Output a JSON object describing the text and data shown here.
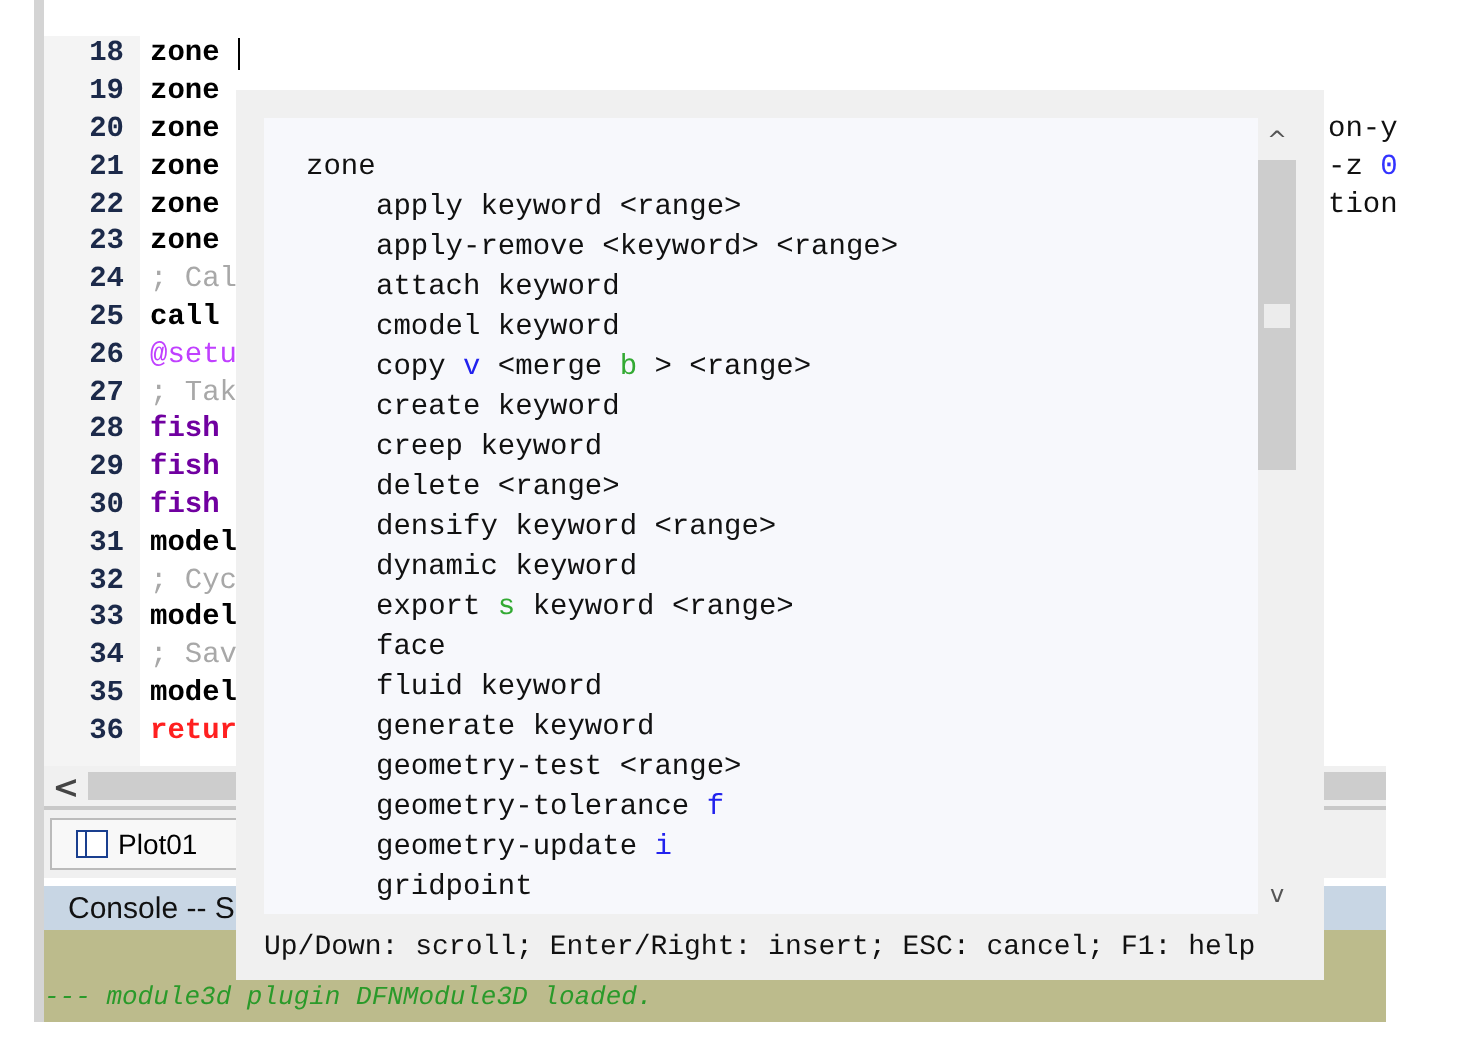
{
  "editor": {
    "lines": [
      {
        "number": "18",
        "segments": [
          {
            "text": "zone",
            "kind": "keyword"
          }
        ],
        "cursor": true
      },
      {
        "number": "19",
        "segments": [
          {
            "text": "zone",
            "kind": "keyword"
          }
        ],
        "cursor": false
      },
      {
        "number": "20",
        "segments": [
          {
            "text": "zone",
            "kind": "keyword"
          }
        ],
        "tail": [
          {
            "text": "on-y",
            "kind": "plain"
          }
        ],
        "cursor": false
      },
      {
        "number": "21",
        "segments": [
          {
            "text": "zone",
            "kind": "keyword"
          }
        ],
        "tail": [
          {
            "text": "-z ",
            "kind": "plain"
          },
          {
            "text": "0",
            "kind": "number"
          }
        ],
        "cursor": false
      },
      {
        "number": "22",
        "segments": [
          {
            "text": "zone",
            "kind": "keyword"
          }
        ],
        "tail": [
          {
            "text": "tion",
            "kind": "plain"
          }
        ],
        "cursor": false
      },
      {
        "number": "23",
        "segments": [
          {
            "text": "zone",
            "kind": "keyword"
          }
        ],
        "cursor": false
      },
      {
        "number": "24",
        "segments": [
          {
            "text": "; Cal",
            "kind": "comment"
          }
        ],
        "cursor": false
      },
      {
        "number": "25",
        "segments": [
          {
            "text": "call",
            "kind": "keyword"
          }
        ],
        "cursor": false
      },
      {
        "number": "26",
        "segments": [
          {
            "text": "@setu",
            "kind": "macro"
          }
        ],
        "cursor": false
      },
      {
        "number": "27",
        "segments": [
          {
            "text": "; Tak",
            "kind": "comment"
          }
        ],
        "cursor": false
      },
      {
        "number": "28",
        "segments": [
          {
            "text": "fish",
            "kind": "fish"
          }
        ],
        "cursor": false
      },
      {
        "number": "29",
        "segments": [
          {
            "text": "fish",
            "kind": "fish"
          }
        ],
        "cursor": false
      },
      {
        "number": "30",
        "segments": [
          {
            "text": "fish",
            "kind": "fish"
          }
        ],
        "cursor": false
      },
      {
        "number": "31",
        "segments": [
          {
            "text": "model",
            "kind": "keyword"
          }
        ],
        "cursor": false
      },
      {
        "number": "32",
        "segments": [
          {
            "text": "; Cyc",
            "kind": "comment"
          }
        ],
        "cursor": false
      },
      {
        "number": "33",
        "segments": [
          {
            "text": "model",
            "kind": "keyword"
          }
        ],
        "cursor": false
      },
      {
        "number": "34",
        "segments": [
          {
            "text": "; Sav",
            "kind": "comment"
          }
        ],
        "cursor": false
      },
      {
        "number": "35",
        "segments": [
          {
            "text": "model",
            "kind": "keyword"
          }
        ],
        "cursor": false
      },
      {
        "number": "36",
        "segments": [
          {
            "text": "retur",
            "kind": "return"
          }
        ],
        "cursor": false
      }
    ],
    "scroll_left": "<"
  },
  "tabs": [
    {
      "label": "Plot01",
      "selected": true
    }
  ],
  "console": {
    "title": "Console -- S",
    "output": "--- module3d plugin DFNModule3D loaded."
  },
  "completion_popup": {
    "root": {
      "label": "zone",
      "children": [
        {
          "segments": [
            {
              "text": "apply keyword <range>",
              "kind": "plain"
            }
          ]
        },
        {
          "segments": [
            {
              "text": "apply-remove <keyword> <range>",
              "kind": "plain"
            }
          ]
        },
        {
          "segments": [
            {
              "text": "attach keyword",
              "kind": "plain"
            }
          ]
        },
        {
          "segments": [
            {
              "text": "cmodel keyword",
              "kind": "plain"
            }
          ]
        },
        {
          "segments": [
            {
              "text": "copy ",
              "kind": "plain"
            },
            {
              "text": "v",
              "kind": "vector"
            },
            {
              "text": " <merge ",
              "kind": "plain"
            },
            {
              "text": "b",
              "kind": "boolean"
            },
            {
              "text": " > <range>",
              "kind": "plain"
            }
          ]
        },
        {
          "segments": [
            {
              "text": "create keyword",
              "kind": "plain"
            }
          ]
        },
        {
          "segments": [
            {
              "text": "creep keyword",
              "kind": "plain"
            }
          ]
        },
        {
          "segments": [
            {
              "text": "delete <range>",
              "kind": "plain"
            }
          ]
        },
        {
          "segments": [
            {
              "text": "densify keyword <range>",
              "kind": "plain"
            }
          ]
        },
        {
          "segments": [
            {
              "text": "dynamic keyword",
              "kind": "plain"
            }
          ]
        },
        {
          "segments": [
            {
              "text": "export ",
              "kind": "plain"
            },
            {
              "text": "s",
              "kind": "string"
            },
            {
              "text": " keyword <range>",
              "kind": "plain"
            }
          ]
        },
        {
          "segments": [
            {
              "text": "face",
              "kind": "plain"
            }
          ]
        },
        {
          "segments": [
            {
              "text": "fluid keyword",
              "kind": "plain"
            }
          ]
        },
        {
          "segments": [
            {
              "text": "generate keyword",
              "kind": "plain"
            }
          ]
        },
        {
          "segments": [
            {
              "text": "geometry-test <range>",
              "kind": "plain"
            }
          ]
        },
        {
          "segments": [
            {
              "text": "geometry-tolerance ",
              "kind": "plain"
            },
            {
              "text": "f",
              "kind": "float"
            }
          ]
        },
        {
          "segments": [
            {
              "text": "geometry-update ",
              "kind": "plain"
            },
            {
              "text": "i",
              "kind": "integer"
            }
          ]
        },
        {
          "segments": [
            {
              "text": "gridpoint",
              "kind": "plain"
            }
          ]
        }
      ]
    },
    "scroll_up": "^",
    "scroll_down": "v",
    "hint": "Up/Down: scroll; Enter/Right: insert; ESC: cancel; F1: help"
  }
}
